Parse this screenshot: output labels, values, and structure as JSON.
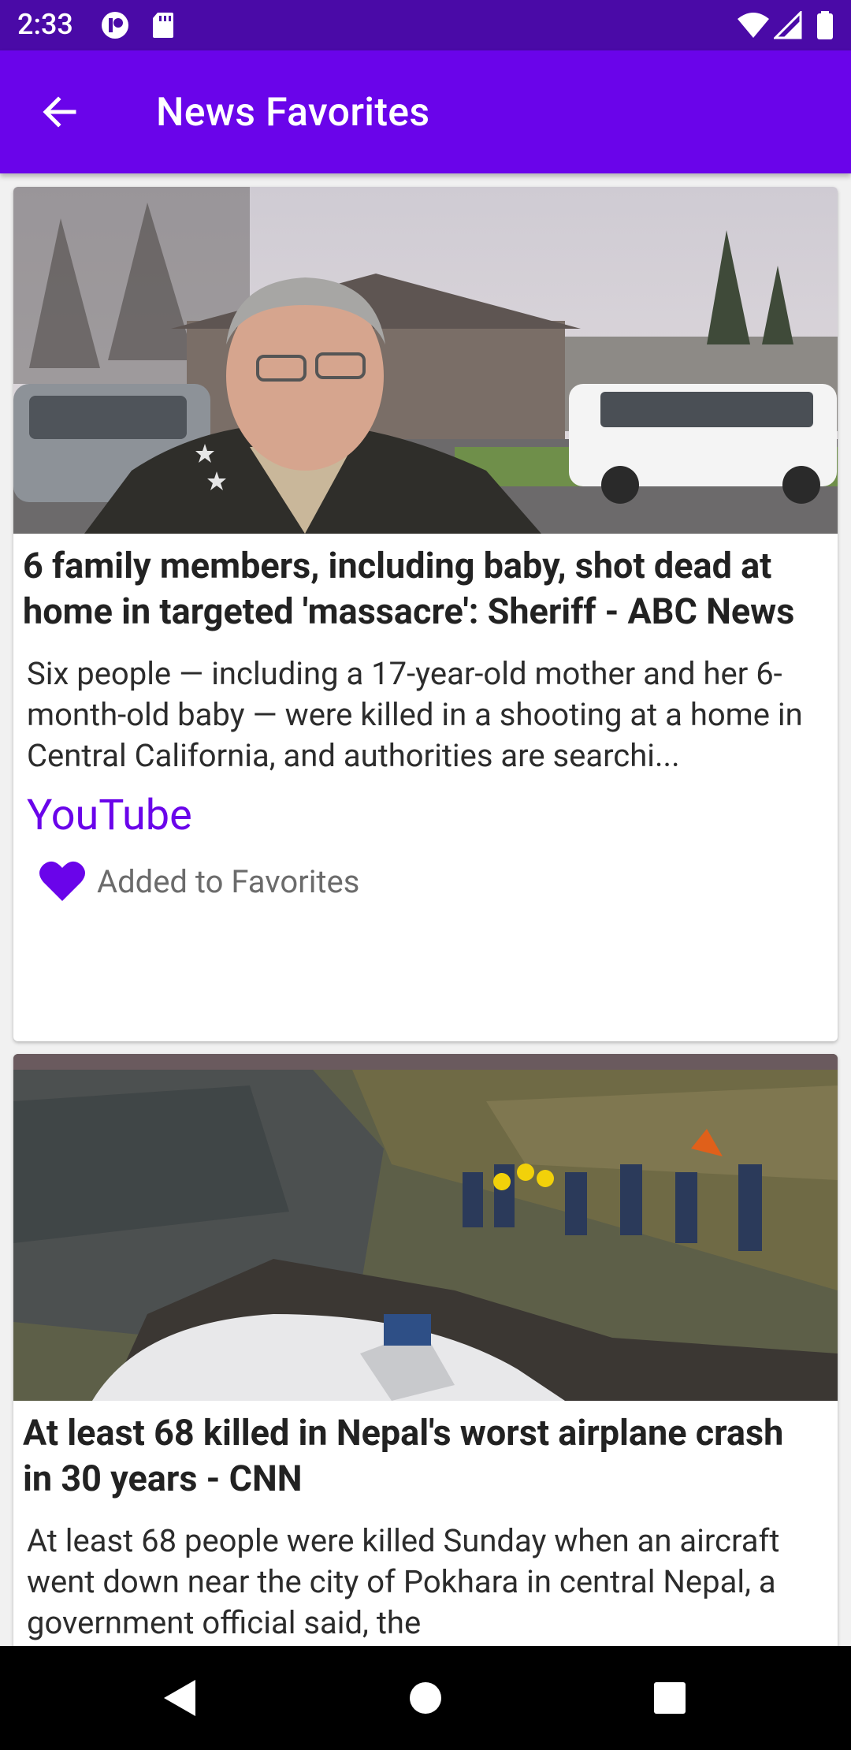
{
  "status_bar": {
    "time": "2:33",
    "icons": [
      "notification-icon",
      "sd-card-icon",
      "wifi-icon",
      "signal-icon",
      "battery-icon"
    ]
  },
  "app_bar": {
    "title": "News Favorites",
    "back_icon": "arrow-left-icon"
  },
  "colors": {
    "status_bar": "#4a0aa7",
    "app_bar": "#6a04ea",
    "accent": "#6a04ea"
  },
  "articles": [
    {
      "title": "6 family members, including baby, shot dead at home in targeted 'massacre': Sheriff - ABC News",
      "description": "Six people — including a 17-year-old mother and her 6-month-old baby — were killed in a shooting at a home in Central California, and authorities are searchi...",
      "source": "YouTube",
      "favorite_label": "Added to Favorites",
      "favorite_icon": "heart-icon"
    },
    {
      "title": "At least 68 killed in Nepal's worst airplane crash in 30 years - CNN",
      "description": "At least 68 people were killed Sunday when an aircraft went down near the city of Pokhara in central Nepal, a government official said, the"
    }
  ],
  "nav_bar": {
    "icons": [
      "back-triangle-icon",
      "home-circle-icon",
      "recents-square-icon"
    ]
  }
}
